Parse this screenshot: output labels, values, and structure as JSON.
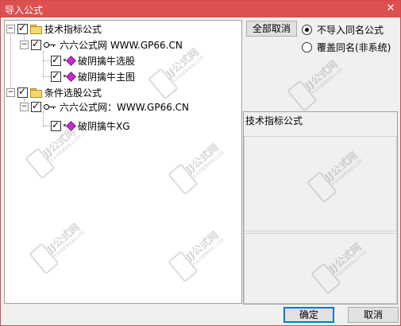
{
  "window": {
    "title": "导入公式",
    "close_glyph": "✕"
  },
  "tree": {
    "expand_glyph": "−",
    "check_glyph": "✓",
    "groups": [
      {
        "label": "技术指标公式",
        "checked": true,
        "source": {
          "label": "六六公式网 WWW.GP66.CN",
          "checked": true,
          "items": [
            {
              "label": "破阴擒牛选股",
              "checked": true
            },
            {
              "label": "破阴擒牛主图",
              "checked": true
            }
          ]
        }
      },
      {
        "label": "条件选股公式",
        "checked": true,
        "source": {
          "label": "六六公式网：WWW.GP66.CN",
          "checked": true,
          "items": [
            {
              "label": "破阴擒牛XG",
              "checked": true
            }
          ]
        }
      }
    ]
  },
  "options": {
    "cancel_all_label": "全部取消",
    "radio_no_import": "不导入同名公式",
    "radio_overwrite": "覆盖同名(非系统)",
    "selected": "no_import"
  },
  "info": {
    "formula_type": "技术指标公式"
  },
  "footer": {
    "ok_label": "确定",
    "cancel_label": "取消"
  },
  "watermark": {
    "text": "JJ公式网",
    "sub": "专业的股票指标公式网"
  },
  "colors": {
    "titlebar": "#dc5050",
    "formula_icon": "#c52bd1",
    "folder": "#f5d96f"
  }
}
